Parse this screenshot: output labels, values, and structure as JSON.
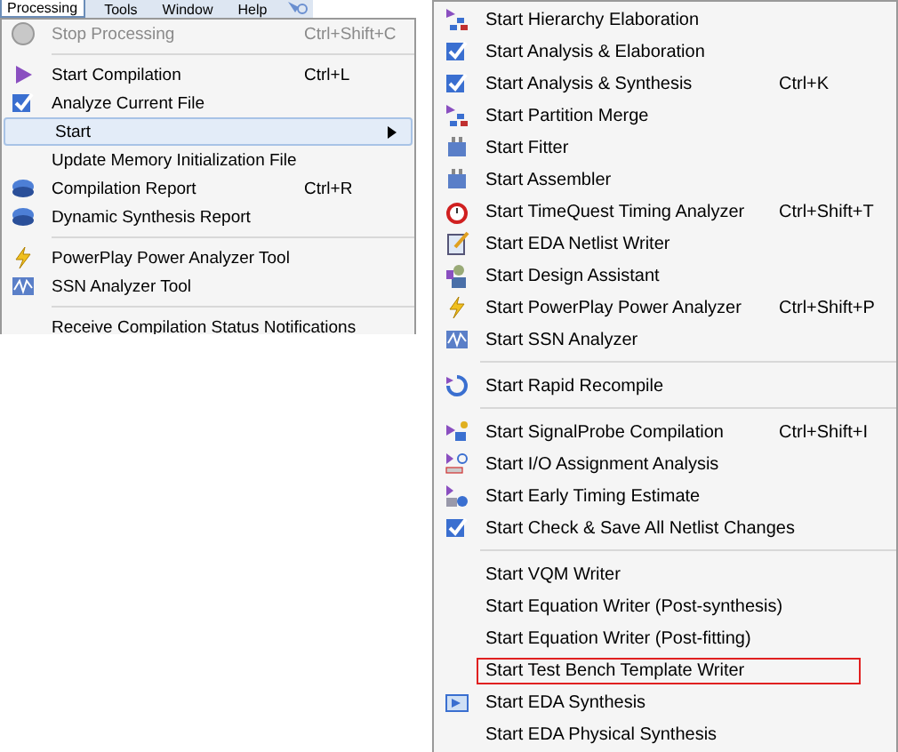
{
  "menubar": [
    {
      "label": "Processing",
      "selected": true
    },
    {
      "label": "Tools",
      "selected": false
    },
    {
      "label": "Window",
      "selected": false
    },
    {
      "label": "Help",
      "selected": false
    }
  ],
  "processing_menu": [
    {
      "kind": "item",
      "label": "Stop Processing",
      "shortcut": "Ctrl+Shift+C",
      "disabled": true,
      "selected": false
    },
    {
      "kind": "separator"
    },
    {
      "kind": "item",
      "label": "Start Compilation",
      "shortcut": "Ctrl+L",
      "disabled": false,
      "selected": false
    },
    {
      "kind": "item",
      "label": "Analyze Current File",
      "disabled": false,
      "selected": false
    },
    {
      "kind": "submenu",
      "label": "Start",
      "disabled": false,
      "selected": true
    },
    {
      "kind": "item",
      "label": "Update Memory Initialization File",
      "disabled": false,
      "selected": false
    },
    {
      "kind": "item",
      "label": "Compilation Report",
      "shortcut": "Ctrl+R",
      "disabled": false,
      "selected": false
    },
    {
      "kind": "item",
      "label": "Dynamic Synthesis Report",
      "disabled": false,
      "selected": false
    },
    {
      "kind": "separator"
    },
    {
      "kind": "item",
      "label": "PowerPlay Power Analyzer Tool",
      "disabled": false,
      "selected": false
    },
    {
      "kind": "item",
      "label": "SSN Analyzer Tool",
      "disabled": false,
      "selected": false
    },
    {
      "kind": "separator"
    },
    {
      "kind": "item",
      "label": "Receive Compilation Status Notifications",
      "disabled": false,
      "selected": false
    }
  ],
  "start_submenu": [
    {
      "kind": "item",
      "label": "Start Hierarchy Elaboration",
      "outlined": false
    },
    {
      "kind": "item",
      "label": "Start Analysis & Elaboration",
      "outlined": false
    },
    {
      "kind": "item",
      "label": "Start Analysis & Synthesis",
      "shortcut": "Ctrl+K",
      "outlined": false
    },
    {
      "kind": "item",
      "label": "Start Partition Merge",
      "outlined": false
    },
    {
      "kind": "item",
      "label": "Start Fitter",
      "outlined": false
    },
    {
      "kind": "item",
      "label": "Start Assembler",
      "outlined": false
    },
    {
      "kind": "item",
      "label": "Start TimeQuest Timing Analyzer",
      "shortcut": "Ctrl+Shift+T",
      "outlined": false
    },
    {
      "kind": "item",
      "label": "Start EDA Netlist Writer",
      "outlined": false
    },
    {
      "kind": "item",
      "label": "Start Design Assistant",
      "outlined": false
    },
    {
      "kind": "item",
      "label": "Start PowerPlay Power Analyzer",
      "shortcut": "Ctrl+Shift+P",
      "outlined": false
    },
    {
      "kind": "item",
      "label": "Start SSN Analyzer",
      "outlined": false
    },
    {
      "kind": "separator"
    },
    {
      "kind": "item",
      "label": "Start Rapid Recompile",
      "outlined": false
    },
    {
      "kind": "separator"
    },
    {
      "kind": "item",
      "label": "Start SignalProbe Compilation",
      "shortcut": "Ctrl+Shift+I",
      "outlined": false
    },
    {
      "kind": "item",
      "label": "Start I/O Assignment Analysis",
      "outlined": false
    },
    {
      "kind": "item",
      "label": "Start Early Timing Estimate",
      "outlined": false
    },
    {
      "kind": "item",
      "label": "Start Check & Save All Netlist Changes",
      "outlined": false
    },
    {
      "kind": "separator"
    },
    {
      "kind": "item",
      "label": "Start VQM Writer",
      "outlined": false
    },
    {
      "kind": "item",
      "label": "Start Equation Writer (Post-synthesis)",
      "outlined": false
    },
    {
      "kind": "item",
      "label": "Start Equation Writer (Post-fitting)",
      "outlined": false
    },
    {
      "kind": "item",
      "label": "Start Test Bench Template Writer",
      "outlined": true
    },
    {
      "kind": "item",
      "label": "Start EDA Synthesis",
      "outlined": false
    },
    {
      "kind": "item",
      "label": "Start EDA Physical Synthesis",
      "outlined": false
    }
  ]
}
